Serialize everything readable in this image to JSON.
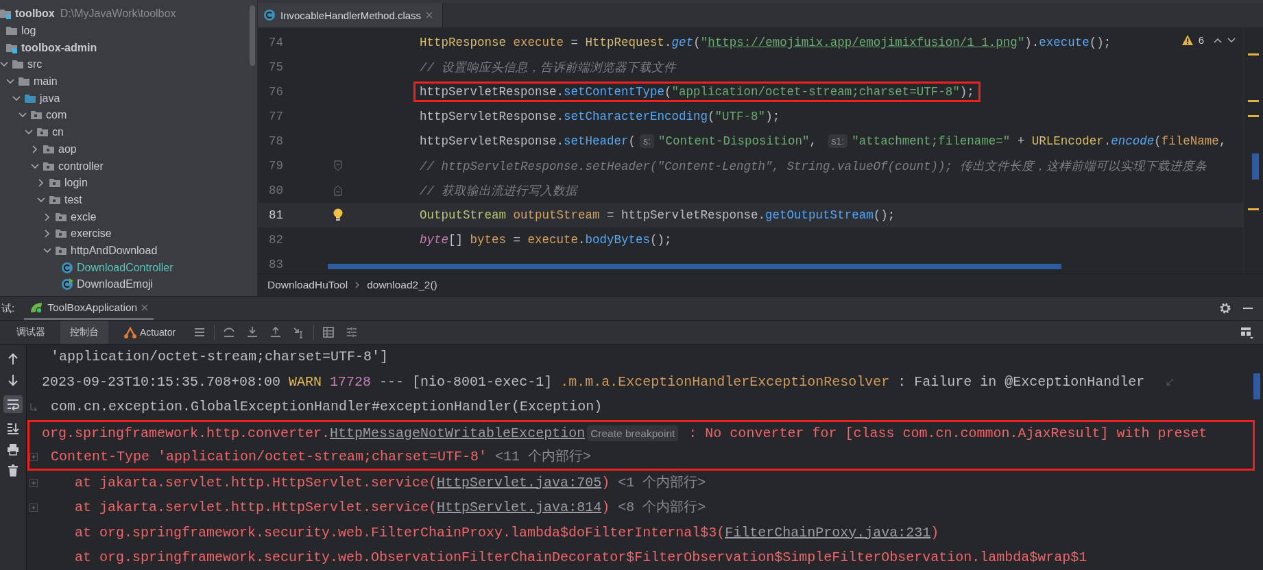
{
  "project_tree": {
    "items": [
      {
        "label": "toolbox",
        "path": "D:\\MyJavaWork\\toolbox",
        "kind": "module",
        "children": [
          {
            "label": "log",
            "kind": "folder"
          },
          {
            "label": "toolbox-admin",
            "kind": "module",
            "children": [
              {
                "label": "src",
                "kind": "folder",
                "expanded": true,
                "children": [
                  {
                    "label": "main",
                    "kind": "folder",
                    "expanded": true,
                    "children": [
                      {
                        "label": "java",
                        "kind": "source-root",
                        "expanded": true,
                        "children": [
                          {
                            "label": "com",
                            "kind": "package",
                            "expanded": true,
                            "children": [
                              {
                                "label": "cn",
                                "kind": "package",
                                "expanded": true,
                                "children": [
                                  {
                                    "label": "aop",
                                    "kind": "package",
                                    "expanded": false
                                  },
                                  {
                                    "label": "controller",
                                    "kind": "package",
                                    "expanded": true,
                                    "children": [
                                      {
                                        "label": "login",
                                        "kind": "package",
                                        "expanded": false
                                      },
                                      {
                                        "label": "test",
                                        "kind": "package",
                                        "expanded": true,
                                        "children": [
                                          {
                                            "label": "excle",
                                            "kind": "package",
                                            "expanded": false
                                          },
                                          {
                                            "label": "exercise",
                                            "kind": "package",
                                            "expanded": false
                                          },
                                          {
                                            "label": "httpAndDownload",
                                            "kind": "package",
                                            "expanded": true,
                                            "children": [
                                              {
                                                "label": "DownloadController",
                                                "kind": "class",
                                                "color": "#5cc4c0"
                                              },
                                              {
                                                "label": "DownloadEmoji",
                                                "kind": "runnable-class",
                                                "color": "#c9ccd1"
                                              }
                                            ]
                                          }
                                        ]
                                      }
                                    ]
                                  }
                                ]
                              }
                            ]
                          }
                        ]
                      }
                    ]
                  }
                ]
              }
            ]
          }
        ]
      }
    ]
  },
  "editor": {
    "tab": {
      "label": "InvocableHandlerMethod.class",
      "selected": true
    },
    "warning_count": "6",
    "lines": [
      {
        "number": "74",
        "current": false,
        "boxed": false,
        "tokens": [
          {
            "kind": "type",
            "text": "HttpResponse "
          },
          {
            "kind": "local",
            "text": "execute"
          },
          {
            "kind": "plain",
            "text": " = "
          },
          {
            "kind": "type",
            "text": "HttpRequest"
          },
          {
            "kind": "plain",
            "text": "."
          },
          {
            "kind": "static",
            "text": "get"
          },
          {
            "kind": "plain",
            "text": "("
          },
          {
            "kind": "string",
            "text": "\""
          },
          {
            "kind": "url",
            "text": "https://emojimix.app/emojimixfusion/1_1.png"
          },
          {
            "kind": "string",
            "text": "\""
          },
          {
            "kind": "plain",
            "text": ")."
          },
          {
            "kind": "method",
            "text": "execute"
          },
          {
            "kind": "plain",
            "text": "();"
          }
        ]
      },
      {
        "number": "75",
        "current": false,
        "boxed": false,
        "tokens": [
          {
            "kind": "comment",
            "text": "// 设置响应头信息，告诉前端浏览器下载文件"
          }
        ]
      },
      {
        "number": "76",
        "current": false,
        "boxed": true,
        "tokens": [
          {
            "kind": "plain",
            "text": "httpServletResponse."
          },
          {
            "kind": "method",
            "text": "setContentType"
          },
          {
            "kind": "plain",
            "text": "("
          },
          {
            "kind": "string",
            "text": "\"application/octet-stream;charset=UTF-8\""
          },
          {
            "kind": "plain",
            "text": ");"
          }
        ]
      },
      {
        "number": "77",
        "current": false,
        "boxed": false,
        "tokens": [
          {
            "kind": "plain",
            "text": "httpServletResponse."
          },
          {
            "kind": "method",
            "text": "setCharacterEncoding"
          },
          {
            "kind": "plain",
            "text": "("
          },
          {
            "kind": "string",
            "text": "\"UTF-8\""
          },
          {
            "kind": "plain",
            "text": ");"
          }
        ]
      },
      {
        "number": "78",
        "current": false,
        "boxed": false,
        "tokens": [
          {
            "kind": "plain",
            "text": "httpServletResponse."
          },
          {
            "kind": "method",
            "text": "setHeader"
          },
          {
            "kind": "plain",
            "text": "("
          },
          {
            "kind": "hint",
            "text": "s:"
          },
          {
            "kind": "string",
            "text": "\"Content-Disposition\""
          },
          {
            "kind": "plain",
            "text": ", "
          },
          {
            "kind": "hint",
            "text": "s1:"
          },
          {
            "kind": "string",
            "text": "\"attachment;filename=\""
          },
          {
            "kind": "plain",
            "text": " + "
          },
          {
            "kind": "type",
            "text": "URLEncoder"
          },
          {
            "kind": "plain",
            "text": "."
          },
          {
            "kind": "static",
            "text": "encode"
          },
          {
            "kind": "plain",
            "text": "("
          },
          {
            "kind": "local",
            "text": "fileName"
          },
          {
            "kind": "plain",
            "text": ","
          }
        ]
      },
      {
        "number": "79",
        "current": false,
        "boxed": false,
        "marker": {
          "kind": "fold-start"
        },
        "tokens": [
          {
            "kind": "comment",
            "text": "// httpServletResponse.setHeader(\"Content-Length\", String.valueOf(count)); 传出文件长度，这样前端可以实现下载进度条"
          }
        ]
      },
      {
        "number": "80",
        "current": false,
        "boxed": false,
        "marker": {
          "kind": "fold-end"
        },
        "tokens": [
          {
            "kind": "comment",
            "text": "// 获取输出流进行写入数据"
          }
        ]
      },
      {
        "number": "81",
        "current": true,
        "boxed": false,
        "marker": {
          "kind": "bulb"
        },
        "tokens": [
          {
            "kind": "interface",
            "text": "OutputStream "
          },
          {
            "kind": "local",
            "text": "outputStream"
          },
          {
            "kind": "plain",
            "text": " = httpServletResponse."
          },
          {
            "kind": "method",
            "text": "getOutputStream"
          },
          {
            "kind": "plain",
            "text": "();"
          }
        ]
      },
      {
        "number": "82",
        "current": false,
        "boxed": false,
        "tokens": [
          {
            "kind": "keyword",
            "text": "byte"
          },
          {
            "kind": "plain",
            "text": "[] "
          },
          {
            "kind": "local",
            "text": "bytes"
          },
          {
            "kind": "plain",
            "text": " = "
          },
          {
            "kind": "local",
            "text": "execute"
          },
          {
            "kind": "plain",
            "text": "."
          },
          {
            "kind": "method",
            "text": "bodyBytes"
          },
          {
            "kind": "plain",
            "text": "();"
          }
        ]
      },
      {
        "number": "83",
        "current": false
      }
    ],
    "breadcrumbs": [
      "DownloadHuTool",
      "download2_2()"
    ]
  },
  "run_panel": {
    "label": "试:",
    "tabs": [
      {
        "label": "ToolBoxApplication",
        "selected": true
      }
    ],
    "tool_tabs": [
      {
        "label": "调试器",
        "selected": false
      },
      {
        "label": "控制台",
        "selected": true
      },
      {
        "label": "Actuator",
        "selected": false
      }
    ],
    "soft_wrap": true,
    "console": {
      "lines": [
        {
          "kind": "continuation",
          "boxed": false,
          "tokens": [
            {
              "kind": "plain",
              "text": "'application/octet-stream;charset=UTF-8']"
            }
          ]
        },
        {
          "kind": "entry",
          "boxed": false,
          "wrapped": true,
          "tokens": [
            {
              "kind": "plain",
              "text": "2023-09-23T10:15:35.708+08:00  "
            },
            {
              "kind": "warn",
              "text": "WARN "
            },
            {
              "kind": "pid",
              "text": "17728"
            },
            {
              "kind": "plain",
              "text": " --- [nio-8001-exec-1] "
            },
            {
              "kind": "logger",
              "text": ".m.m.a.ExceptionHandlerExceptionResolver"
            },
            {
              "kind": "plain",
              "text": " : Failure in @ExceptionHandler"
            }
          ]
        },
        {
          "kind": "continuation",
          "boxed": false,
          "gutter": {
            "kind": "wrap"
          },
          "tokens": [
            {
              "kind": "plain",
              "text": "com.cn.exception.GlobalExceptionHandler#exceptionHandler(Exception)"
            }
          ]
        },
        {
          "kind": "entry",
          "boxed": true,
          "tokens": [
            {
              "kind": "error",
              "text": "org.springframework.http.converter."
            },
            {
              "kind": "link",
              "text": "HttpMessageNotWritableException"
            },
            {
              "kind": "inlay",
              "text": "Create breakpoint"
            },
            {
              "kind": "error",
              "text": " : No converter for [class com.cn.common.AjaxResult] with preset"
            }
          ]
        },
        {
          "kind": "continuation",
          "boxed": true,
          "gutter": {
            "kind": "expand"
          },
          "tokens": [
            {
              "kind": "error",
              "text": "Content-Type 'application/octet-stream;charset=UTF-8' "
            },
            {
              "kind": "folded",
              "text": "<11 个内部行>"
            }
          ]
        },
        {
          "kind": "frame",
          "boxed": false,
          "gutter": {
            "kind": "expand"
          },
          "tokens": [
            {
              "kind": "error",
              "text": "at jakarta.servlet.http.HttpServlet.service("
            },
            {
              "kind": "link",
              "text": "HttpServlet.java:705"
            },
            {
              "kind": "error",
              "text": ")"
            },
            {
              "kind": "folded",
              "text": " <1 个内部行>"
            }
          ]
        },
        {
          "kind": "frame",
          "boxed": false,
          "gutter": {
            "kind": "expand"
          },
          "tokens": [
            {
              "kind": "error",
              "text": "at jakarta.servlet.http.HttpServlet.service("
            },
            {
              "kind": "link",
              "text": "HttpServlet.java:814"
            },
            {
              "kind": "error",
              "text": ")"
            },
            {
              "kind": "folded",
              "text": " <8 个内部行>"
            }
          ]
        },
        {
          "kind": "frame",
          "boxed": false,
          "tokens": [
            {
              "kind": "error",
              "text": "at org.springframework.security.web.FilterChainProxy.lambda$doFilterInternal$3("
            },
            {
              "kind": "link",
              "text": "FilterChainProxy.java:231"
            },
            {
              "kind": "error",
              "text": ")"
            }
          ]
        },
        {
          "kind": "frame",
          "boxed": false,
          "tokens": [
            {
              "kind": "error",
              "text": "at org.springframework.security.web.ObservationFilterChainDecorator$FilterObservation$SimpleFilterObservation.lambda$wrap$1"
            }
          ]
        }
      ]
    }
  }
}
